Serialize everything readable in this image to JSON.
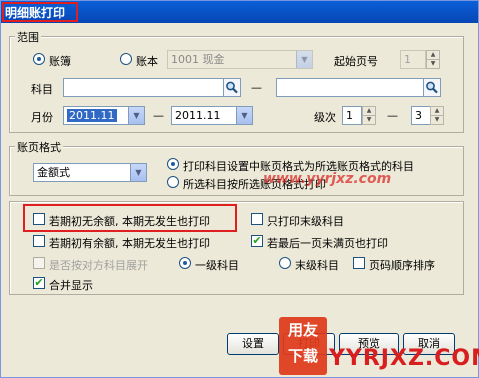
{
  "window": {
    "title": "明细账打印"
  },
  "range": {
    "legend": "范围",
    "radio_ledger": "账簿",
    "radio_book": "账本",
    "book_value": "1001 现金",
    "start_page_label": "起始页号",
    "start_page_value": "1",
    "subject_label": "科目",
    "dash": "—",
    "month_label": "月份",
    "month_from": "2011.11",
    "month_to": "2011.11",
    "level_label": "级次",
    "level_from": "1",
    "level_to": "3"
  },
  "format": {
    "legend": "账页格式",
    "format_value": "金额式",
    "radio_print_setting": "打印科目设置中账页格式为所选账页格式的科目",
    "radio_selected_subjects": "所选科目按所选账页格式打印"
  },
  "options": {
    "opt1": "若期初无余额, 本期无发生也打印",
    "opt2": "只打印末级科目",
    "opt3": "若期初有余额, 本期无发生也打印",
    "opt4": "若最后一页未满页也打印",
    "opt5": "是否按对方科目展开",
    "radio_level1": "一级科目",
    "radio_last_level": "末级科目",
    "opt6": "页码顺序排序",
    "opt7": "合并显示",
    "check_mark": "✔"
  },
  "buttons": {
    "setup": "设置",
    "print": "打印",
    "preview": "预览",
    "cancel": "取消"
  },
  "watermark": {
    "site": "www.yyrjxz.com",
    "logo1": "用友",
    "logo2": "下载",
    "brand": "YYRJXZ.COM"
  }
}
